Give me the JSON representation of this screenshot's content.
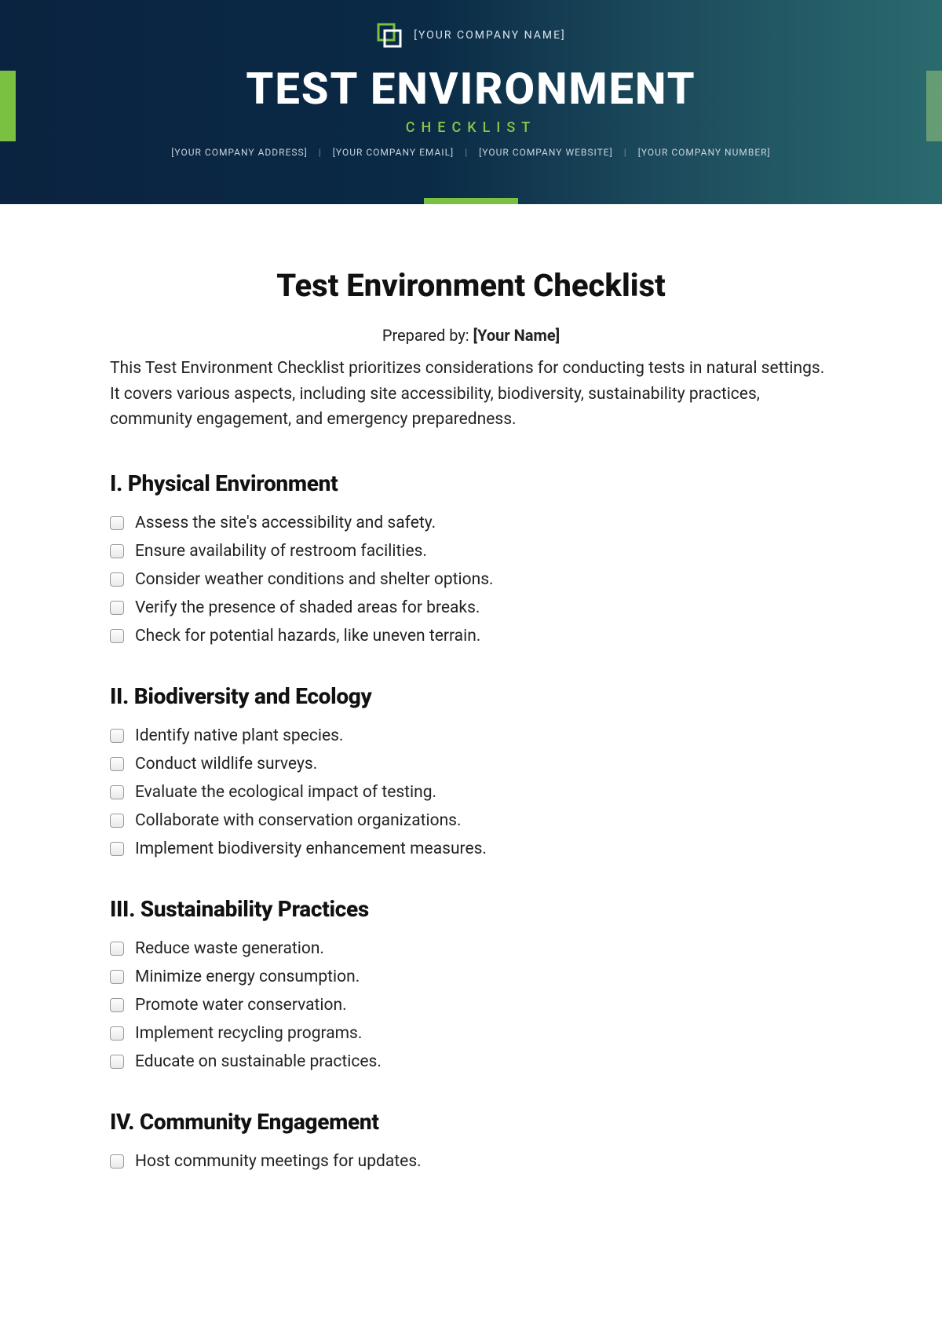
{
  "banner": {
    "company_name": "[YOUR COMPANY NAME]",
    "title": "TEST ENVIRONMENT",
    "subtitle": "CHECKLIST",
    "contact": {
      "address": "[YOUR COMPANY ADDRESS]",
      "email": "[YOUR COMPANY EMAIL]",
      "website": "[YOUR COMPANY WEBSITE]",
      "number": "[YOUR COMPANY NUMBER]"
    }
  },
  "document": {
    "title": "Test Environment Checklist",
    "prepared_by_label": "Prepared by: ",
    "prepared_by_name": "[Your Name]",
    "intro": "This Test Environment Checklist prioritizes considerations for conducting tests in natural settings. It covers various aspects, including site accessibility, biodiversity, sustainability practices, community engagement, and emergency preparedness."
  },
  "sections": [
    {
      "heading": "I. Physical Environment",
      "items": [
        "Assess the site's accessibility and safety.",
        "Ensure availability of restroom facilities.",
        "Consider weather conditions and shelter options.",
        "Verify the presence of shaded areas for breaks.",
        "Check for potential hazards, like uneven terrain."
      ]
    },
    {
      "heading": "II. Biodiversity and Ecology",
      "items": [
        "Identify native plant species.",
        "Conduct wildlife surveys.",
        "Evaluate the ecological impact of testing.",
        "Collaborate with conservation organizations.",
        "Implement biodiversity enhancement measures."
      ]
    },
    {
      "heading": "III. Sustainability Practices",
      "items": [
        "Reduce waste generation.",
        "Minimize energy consumption.",
        "Promote water conservation.",
        "Implement recycling programs.",
        "Educate on sustainable practices."
      ]
    },
    {
      "heading": "IV. Community Engagement",
      "items": [
        "Host community meetings for updates."
      ]
    }
  ]
}
